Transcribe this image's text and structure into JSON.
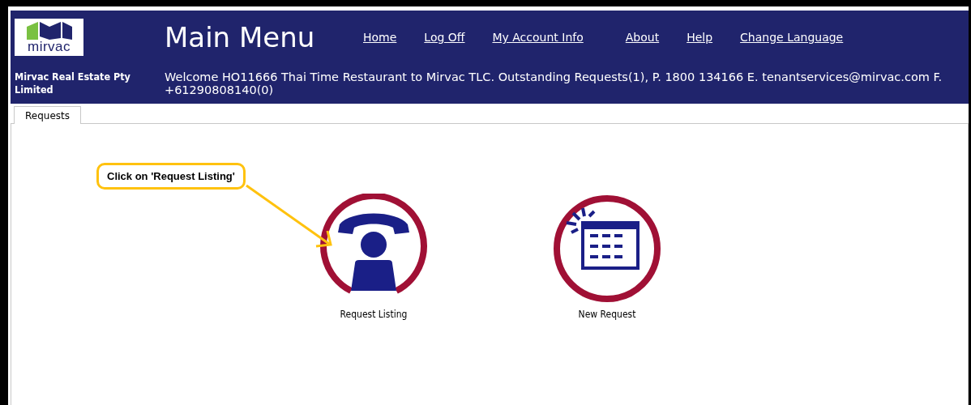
{
  "header": {
    "logo_text": "mirvac",
    "title": "Main Menu",
    "nav_links": [
      "Home",
      "Log Off",
      "My Account Info",
      "About",
      "Help",
      "Change Language"
    ],
    "company": "Mirvac Real Estate Pty Limited",
    "welcome": "Welcome HO11666 Thai Time Restaurant to Mirvac TLC. Outstanding Requests(1), P. 1800 134166 E. tenantservices@mirvac.com F. +61290808140(0)"
  },
  "tabs": [
    {
      "label": "Requests",
      "selected": true
    }
  ],
  "tiles": [
    {
      "label": "Request Listing",
      "kind": "phone"
    },
    {
      "label": "New Request",
      "kind": "calendar"
    }
  ],
  "callout": {
    "text": "Click on 'Request Listing'"
  }
}
